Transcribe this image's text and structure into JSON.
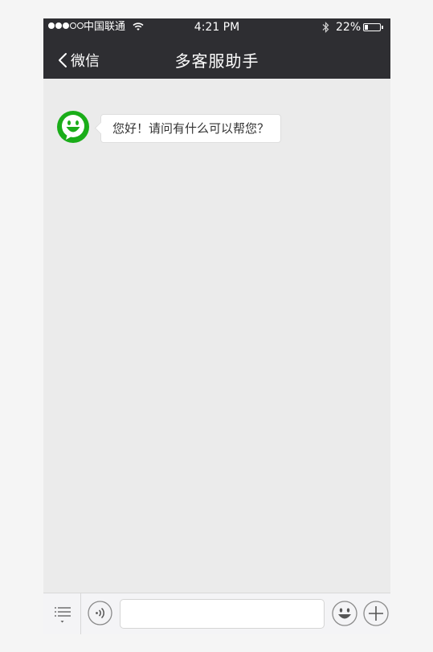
{
  "status_bar": {
    "carrier": "中国联通",
    "time": "4:21 PM",
    "battery_percent": "22%",
    "battery_level": 0.22,
    "signal_bars_filled": 3,
    "signal_bars_total": 5
  },
  "nav": {
    "back_label": "微信",
    "title": "多客服助手"
  },
  "messages": [
    {
      "sender": "bot",
      "text": "您好！请问有什么可以帮您？"
    }
  ],
  "input": {
    "value": "",
    "placeholder": ""
  },
  "icons": {
    "back": "chevron-left-icon",
    "menu": "list-menu-icon",
    "voice": "voice-icon",
    "emoji": "emoji-icon",
    "plus": "plus-icon",
    "avatar": "smiley-avatar-icon"
  },
  "colors": {
    "nav_bg": "#2e2e32",
    "chat_bg": "#ebebeb",
    "avatar_green": "#1aad19"
  }
}
